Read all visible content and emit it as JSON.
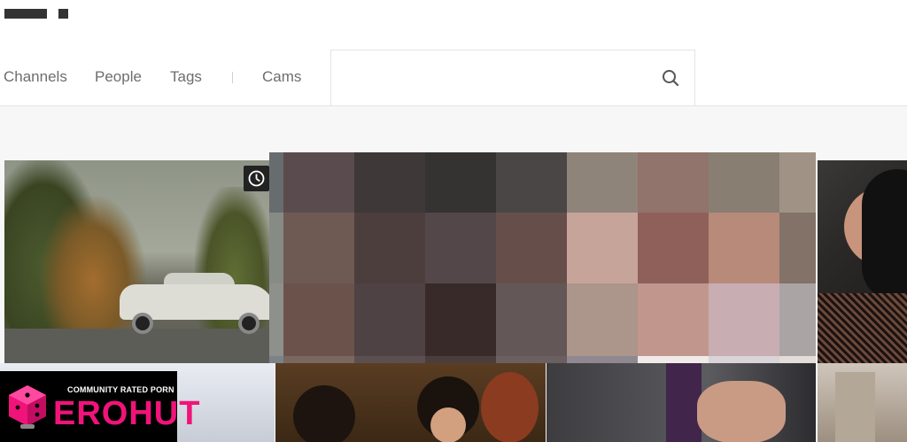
{
  "nav": {
    "links": [
      "Channels",
      "People",
      "Tags",
      "Cams"
    ],
    "search": {
      "placeholder": "",
      "value": ""
    },
    "icons": {
      "search": "search-icon"
    }
  },
  "thumbnails": {
    "watch_later_icon": "clock-icon",
    "pixel_colors": [
      [
        "#676c6e",
        "#5a4c4e",
        "#3e3839",
        "#353232",
        "#4b4646",
        "#8f847a",
        "#91746b",
        "#887e72",
        "#a09385"
      ],
      [
        "#878b86",
        "#6e5a53",
        "#4c3e3d",
        "#54474a",
        "#664f4b",
        "#c7a49a",
        "#8f605a",
        "#b88a79",
        "#827267"
      ],
      [
        "#8d908b",
        "#6b534b",
        "#4f4244",
        "#382a28",
        "#645757",
        "#ac958a",
        "#c1978d",
        "#c8adb2",
        "#aaa4a5"
      ],
      [
        "#7c8287",
        "#7a6860",
        "#5c4f50",
        "#4a3d3c",
        "#6a5f61",
        "#8f8890",
        "#f0ebe9",
        "#d8d4d7",
        "#e3dcd9"
      ]
    ]
  },
  "promo": {
    "tagline": "COMMUNITY RATED PORN",
    "brand": "EROHUT",
    "brand_color": "#f0137a"
  }
}
